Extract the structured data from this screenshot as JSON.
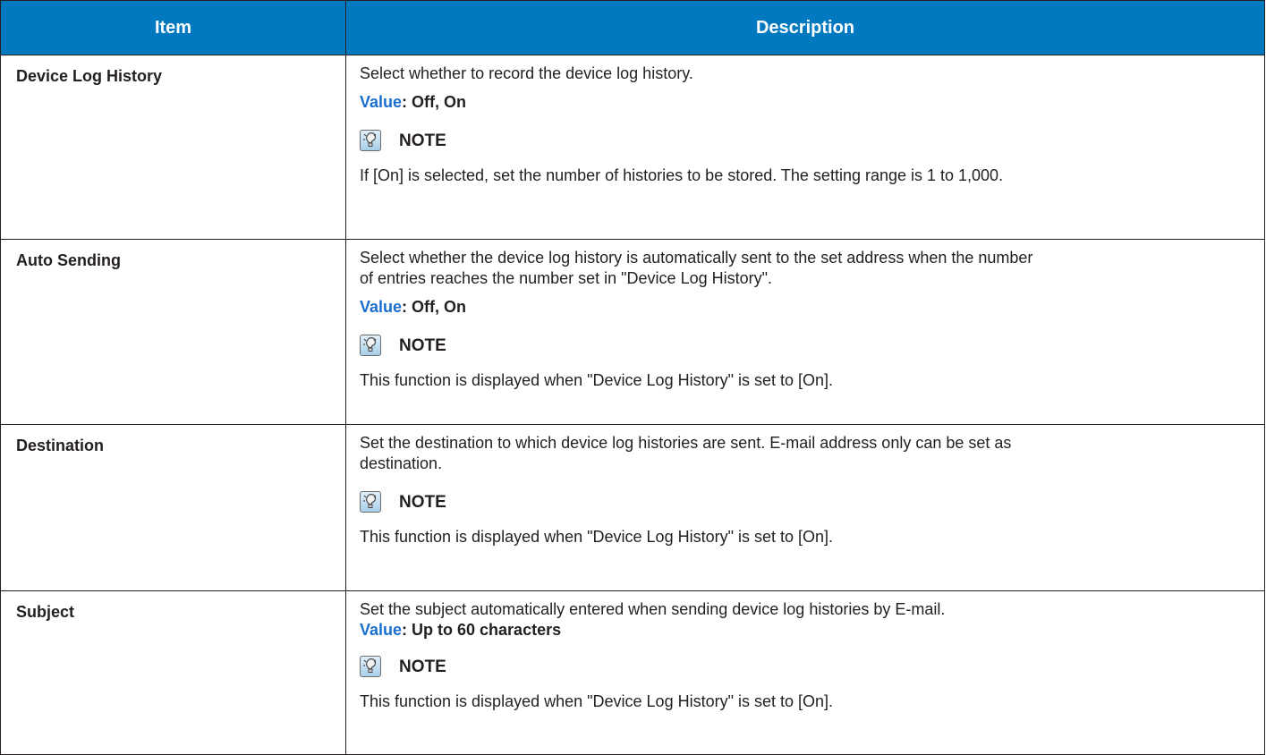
{
  "table": {
    "headers": {
      "item": "Item",
      "description": "Description"
    },
    "rows": [
      {
        "item": "Device Log History",
        "description": "Select whether to record the device log history.",
        "value_label": "Value",
        "value_text": ": Off, On",
        "note_label": "NOTE",
        "note_text": "If [On] is selected, set the number of histories to be stored. The setting range is 1 to 1,000."
      },
      {
        "item": "Auto Sending",
        "description_line1": "Select whether the device log history is automatically sent to the set address when the number",
        "description_line2": "of entries reaches the number set in \"Device Log History\".",
        "value_label": "Value",
        "value_text": ": Off, On",
        "note_label": "NOTE",
        "note_text": "This function is displayed when \"Device Log History\" is set to [On]."
      },
      {
        "item": "Destination",
        "description_line1": "Set the destination to which device log histories are sent. E-mail address only can be set as",
        "description_line2": "destination.",
        "note_label": "NOTE",
        "note_text": "This function is displayed when \"Device Log History\" is set to [On]."
      },
      {
        "item": "Subject",
        "description": "Set the subject automatically entered when sending device log histories by E-mail.",
        "value_label": "Value",
        "value_text": ": Up to 60 characters",
        "note_label": "NOTE",
        "note_text": "This function is displayed when \"Device Log History\" is set to [On]."
      }
    ]
  },
  "icons": {
    "note": "note-lightbulb-icon"
  },
  "colors": {
    "header_bg": "#0079c1",
    "header_text": "#ffffff",
    "value_label": "#1a6fce",
    "border": "#231f20"
  }
}
